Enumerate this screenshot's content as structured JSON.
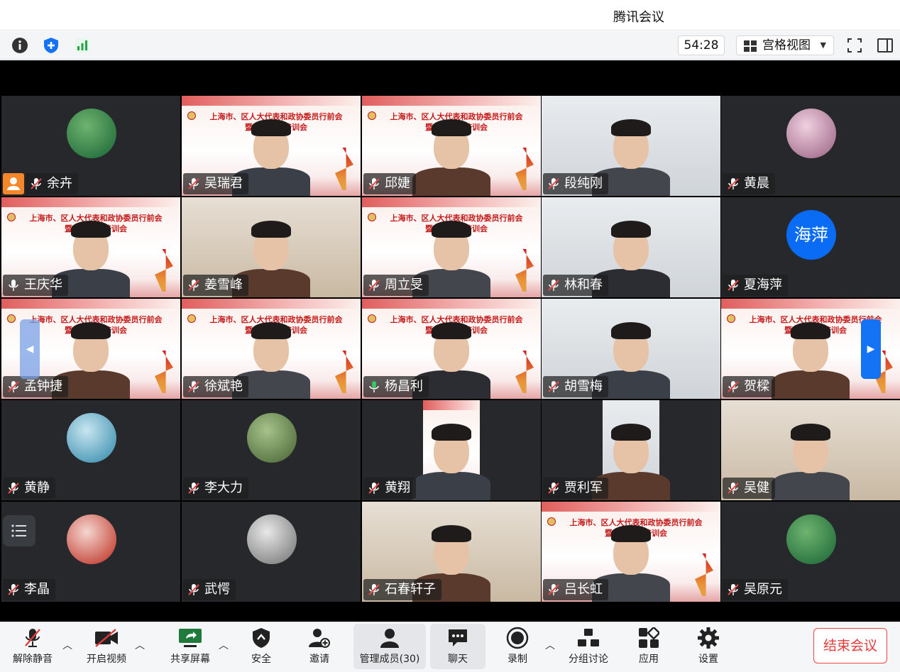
{
  "window": {
    "title": "腾讯会议"
  },
  "toolbar": {
    "timer": "54:28",
    "view_mode": "宫格视图"
  },
  "participants": [
    {
      "name": "余卉",
      "mic": "muted",
      "video": "avatar",
      "host": true
    },
    {
      "name": "吴瑞君",
      "mic": "muted",
      "video": "banner"
    },
    {
      "name": "邱婕",
      "mic": "muted",
      "video": "banner"
    },
    {
      "name": "段纯刚",
      "mic": "muted",
      "video": "room"
    },
    {
      "name": "黄晨",
      "mic": "muted",
      "video": "avatar"
    },
    {
      "name": "王庆华",
      "mic": "on",
      "video": "banner"
    },
    {
      "name": "姜雪峰",
      "mic": "muted",
      "video": "shelf"
    },
    {
      "name": "周立旻",
      "mic": "muted",
      "video": "banner"
    },
    {
      "name": "林和春",
      "mic": "muted",
      "video": "room"
    },
    {
      "name": "夏海萍",
      "mic": "muted",
      "video": "avatar-text",
      "avatar_text": "海萍"
    },
    {
      "name": "孟钟捷",
      "mic": "muted",
      "video": "banner"
    },
    {
      "name": "徐斌艳",
      "mic": "muted",
      "video": "banner"
    },
    {
      "name": "杨昌利",
      "mic": "speaking",
      "video": "banner",
      "active": true
    },
    {
      "name": "胡雪梅",
      "mic": "muted",
      "video": "room"
    },
    {
      "name": "贺樑",
      "mic": "muted",
      "video": "banner"
    },
    {
      "name": "黄静",
      "mic": "muted",
      "video": "avatar"
    },
    {
      "name": "李大力",
      "mic": "muted",
      "video": "avatar"
    },
    {
      "name": "黄翔",
      "mic": "muted",
      "video": "portrait-banner"
    },
    {
      "name": "贾利军",
      "mic": "muted",
      "video": "portrait-room"
    },
    {
      "name": "吴健",
      "mic": "muted",
      "video": "shelf"
    },
    {
      "name": "李晶",
      "mic": "muted",
      "video": "avatar"
    },
    {
      "name": "武愕",
      "mic": "muted",
      "video": "avatar"
    },
    {
      "name": "石春轩子",
      "mic": "muted",
      "video": "shelf"
    },
    {
      "name": "吕长虹",
      "mic": "muted",
      "video": "banner"
    },
    {
      "name": "吴原元",
      "mic": "muted",
      "video": "avatar"
    }
  ],
  "banner": {
    "line1": "上海市、区人大代表和政协委员行前会",
    "line2": "暨参政议政培训会"
  },
  "bottombar": {
    "unmute": "解除静音",
    "start_video": "开启视频",
    "share_screen": "共享屏幕",
    "security": "安全",
    "invite": "邀请",
    "manage_members": "管理成员(30)",
    "chat": "聊天",
    "record": "录制",
    "breakout": "分组讨论",
    "apps": "应用",
    "settings": "设置",
    "end_meeting": "结束会议"
  },
  "colors": {
    "accent_blue": "#1472f5",
    "end_red": "#e23b3b",
    "active_green": "#3ac46a",
    "host_orange": "#f5862a"
  }
}
